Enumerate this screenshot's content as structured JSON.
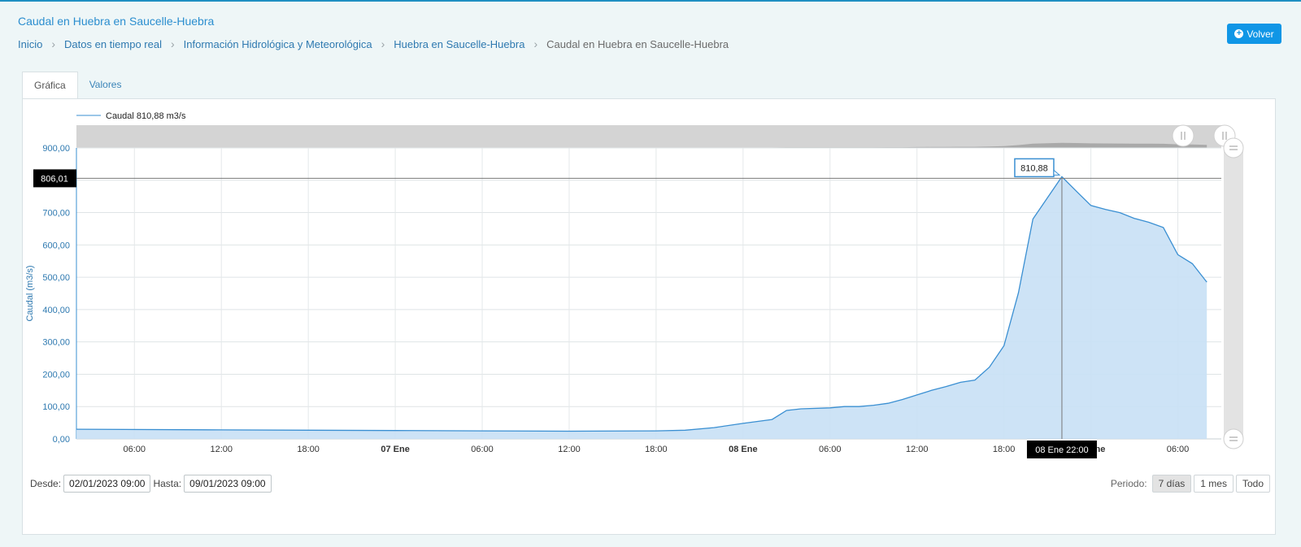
{
  "header": {
    "title": "Caudal en Huebra en Saucelle-Huebra",
    "back_label": "Volver"
  },
  "breadcrumb": [
    "Inicio",
    "Datos en tiempo real",
    "Información Hidrológica y Meteorológica",
    "Huebra en Saucelle-Huebra",
    "Caudal en Huebra en Saucelle-Huebra"
  ],
  "tabs": [
    "Gráfica",
    "Valores"
  ],
  "filters": {
    "desde_label": "Desde:",
    "desde_value": "02/01/2023 09:00",
    "hasta_label": "Hasta:",
    "hasta_value": "09/01/2023 09:00",
    "periodo_label": "Periodo:",
    "periodo_options": [
      "7 días",
      "1 mes",
      "Todo"
    ]
  },
  "colors": {
    "accent": "#1096e6",
    "series_line": "#3a8fd2",
    "series_fill": "#c8e0f5"
  },
  "chart_data": {
    "type": "area",
    "legend": "Caudal 810,88 m3/s",
    "ylim": [
      0,
      900
    ],
    "yticks": [
      {
        "v": 0,
        "label": "0,00"
      },
      {
        "v": 100,
        "label": "100,00"
      },
      {
        "v": 200,
        "label": "200,00"
      },
      {
        "v": 300,
        "label": "300,00"
      },
      {
        "v": 400,
        "label": "400,00"
      },
      {
        "v": 500,
        "label": "500,00"
      },
      {
        "v": 600,
        "label": "600,00"
      },
      {
        "v": 700,
        "label": "700,00"
      },
      {
        "v": 800,
        "label": "800,00"
      },
      {
        "v": 900,
        "label": "900,00"
      }
    ],
    "x_range": [
      "06 Ene 02:00",
      "09 Ene 09:00"
    ],
    "xticks": [
      {
        "t": "06 Ene 06:00",
        "label": "06:00",
        "bold": false
      },
      {
        "t": "06 Ene 12:00",
        "label": "12:00",
        "bold": false
      },
      {
        "t": "06 Ene 18:00",
        "label": "18:00",
        "bold": false
      },
      {
        "t": "07 Ene 00:00",
        "label": "07 Ene",
        "bold": true
      },
      {
        "t": "07 Ene 06:00",
        "label": "06:00",
        "bold": false
      },
      {
        "t": "07 Ene 12:00",
        "label": "12:00",
        "bold": false
      },
      {
        "t": "07 Ene 18:00",
        "label": "18:00",
        "bold": false
      },
      {
        "t": "08 Ene 00:00",
        "label": "08 Ene",
        "bold": true
      },
      {
        "t": "08 Ene 06:00",
        "label": "06:00",
        "bold": false
      },
      {
        "t": "08 Ene 12:00",
        "label": "12:00",
        "bold": false
      },
      {
        "t": "08 Ene 18:00",
        "label": "18:00",
        "bold": false
      },
      {
        "t": "09 Ene 00:00",
        "label": "09 Ene",
        "bold": true
      },
      {
        "t": "09 Ene 06:00",
        "label": "06:00",
        "bold": false
      }
    ],
    "series": [
      {
        "name": "Caudal",
        "unit": "m3/s",
        "x": [
          "06 Ene 02:00",
          "06 Ene 12:00",
          "06 Ene 18:00",
          "07 Ene 00:00",
          "07 Ene 06:00",
          "07 Ene 12:00",
          "07 Ene 18:00",
          "07 Ene 20:00",
          "07 Ene 22:00",
          "08 Ene 00:00",
          "08 Ene 02:00",
          "08 Ene 03:00",
          "08 Ene 04:00",
          "08 Ene 06:00",
          "08 Ene 07:00",
          "08 Ene 08:00",
          "08 Ene 09:00",
          "08 Ene 10:00",
          "08 Ene 11:00",
          "08 Ene 12:00",
          "08 Ene 13:00",
          "08 Ene 14:00",
          "08 Ene 15:00",
          "08 Ene 16:00",
          "08 Ene 17:00",
          "08 Ene 18:00",
          "08 Ene 19:00",
          "08 Ene 20:00",
          "08 Ene 22:00",
          "08 Ene 23:00",
          "09 Ene 00:00",
          "09 Ene 01:00",
          "09 Ene 02:00",
          "09 Ene 03:00",
          "09 Ene 04:00",
          "09 Ene 05:00",
          "09 Ene 06:00",
          "09 Ene 07:00",
          "09 Ene 08:00"
        ],
        "y": [
          30,
          28,
          27,
          26,
          25,
          24,
          25,
          27,
          35,
          48,
          60,
          88,
          93,
          96,
          100,
          100,
          104,
          110,
          122,
          136,
          150,
          162,
          175,
          182,
          222,
          288,
          452,
          680,
          811,
          766,
          722,
          710,
          700,
          682,
          670,
          654,
          570,
          542,
          485
        ]
      }
    ],
    "crosshair": {
      "x": "08 Ene 22:00",
      "x_label": "08 Ene 22:00",
      "y_label": "806,01",
      "y_value": 806.01,
      "tooltip": "810,88"
    },
    "ylabel": "Caudal (m3/s)",
    "grid": true
  }
}
